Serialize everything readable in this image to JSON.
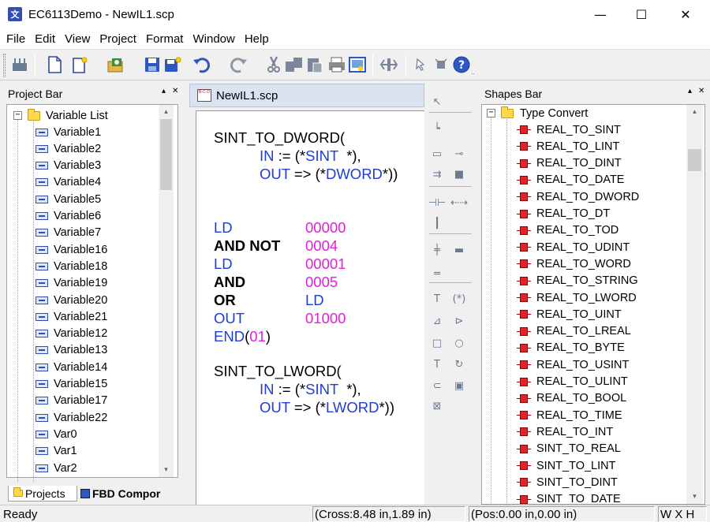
{
  "window": {
    "title": "EC6113Demo - NewIL1.scp",
    "icon_glyph": "文",
    "minimize_glyph": "—",
    "maximize_glyph": "☐",
    "close_glyph": "✕"
  },
  "menu": [
    "File",
    "Edit",
    "View",
    "Project",
    "Format",
    "Window",
    "Help"
  ],
  "toolbar": {
    "icons": [
      "build-icon",
      "new-document-icon",
      "new-from-template-icon",
      "open-project-icon",
      "save-icon",
      "save-all-icon",
      "undo-icon",
      "redo-icon",
      "cut-icon",
      "copy-icon",
      "paste-icon",
      "print-icon",
      "print-preview-icon",
      "split-icon",
      "pointer-icon",
      "stop-icon",
      "help-icon"
    ]
  },
  "project_bar": {
    "title": "Project Bar",
    "pin_glyph": "▴",
    "close_glyph": "✕",
    "root": {
      "label": "Variable List",
      "expander": "−"
    },
    "items": [
      "Variable1",
      "Variable2",
      "Variable3",
      "Variable4",
      "Variable5",
      "Variable6",
      "Variable7",
      "Variable16",
      "Variable18",
      "Variable19",
      "Variable20",
      "Variable21",
      "Variable12",
      "Variable13",
      "Variable14",
      "Variable15",
      "Variable17",
      "Variable22",
      "Var0",
      "Var1",
      "Var2"
    ],
    "tabs": [
      "Projects",
      "FBD Compor"
    ]
  },
  "document": {
    "tab_title": "NewIL1.scp",
    "tab_icon_text": "B-C-D"
  },
  "code": {
    "block1": {
      "func": "SINT_TO_DWORD(",
      "in_kw": "IN",
      "in_op": " := ",
      "in_open": "(*",
      "in_type": "SINT",
      "in_close": "  *),",
      "out_kw": "OUT",
      "out_op": " => ",
      "out_open": "(*",
      "out_type": "DWORD",
      "out_close": "*))"
    },
    "il_lines": [
      {
        "op": "LD",
        "arg": "00000"
      },
      {
        "op": "AND NOT",
        "arg": "0004"
      },
      {
        "op": "LD",
        "arg": "00001"
      },
      {
        "op": "AND",
        "arg": "0005"
      },
      {
        "op": "OR",
        "arg": "LD"
      },
      {
        "op": "OUT",
        "arg": "01000"
      }
    ],
    "end_kw": "END",
    "end_open": "(",
    "end_arg": "01",
    "end_close": ")",
    "block2": {
      "func": "SINT_TO_LWORD(",
      "in_kw": "IN",
      "in_op": " := ",
      "in_open": "(*",
      "in_type": "SINT",
      "in_close": "  *),",
      "out_kw": "OUT",
      "out_op": " => ",
      "out_open": "(*",
      "out_type": "LWORD",
      "out_close": "*))"
    }
  },
  "palette": {
    "icons": [
      "select-pointer-icon",
      "wire-icon",
      "contact-icon",
      "coil-icon",
      "branch-icon",
      "block-icon",
      "h-connect-icon",
      "h-disconnect-icon",
      "vertical-line-icon",
      "cross-icon",
      "element-icon",
      "horizontal-line-icon",
      "text-tool-icon",
      "comment-tool-icon",
      "polyline-icon",
      "polygon-icon",
      "rectangle-icon",
      "ellipse-icon",
      "label-text-icon",
      "rotate-icon",
      "arc-icon",
      "image-icon",
      "freeform-icon"
    ],
    "glyphs": [
      "↖",
      "┕",
      "▭",
      "⊸",
      "⇉",
      "■",
      "⊣⊢",
      "⇠⇢",
      "┃",
      "╪",
      "▬",
      "═",
      "T",
      "(*)",
      "⊿",
      "⊳",
      "□",
      "○",
      "T",
      "↻",
      "⊂",
      "▣",
      "⊠"
    ]
  },
  "shapes_bar": {
    "title": "Shapes Bar",
    "pin_glyph": "▴",
    "close_glyph": "✕",
    "root": {
      "label": "Type Convert",
      "expander": "−"
    },
    "items": [
      "REAL_TO_SINT",
      "REAL_TO_LINT",
      "REAL_TO_DINT",
      "REAL_TO_DATE",
      "REAL_TO_DWORD",
      "REAL_TO_DT",
      "REAL_TO_TOD",
      "REAL_TO_UDINT",
      "REAL_TO_WORD",
      "REAL_TO_STRING",
      "REAL_TO_LWORD",
      "REAL_TO_UINT",
      "REAL_TO_LREAL",
      "REAL_TO_BYTE",
      "REAL_TO_USINT",
      "REAL_TO_ULINT",
      "REAL_TO_BOOL",
      "REAL_TO_TIME",
      "REAL_TO_INT",
      "SINT_TO_REAL",
      "SINT_TO_LINT",
      "SINT_TO_DINT",
      "SINT_TO_DATE"
    ]
  },
  "status": {
    "ready": "Ready",
    "cross": "(Cross:8.48 in,1.89 in)",
    "pos": "(Pos:0.00 in,0.00 in)",
    "size": "W X H",
    "extra": "",
    "scroll_up": "▴",
    "scroll_down": "▾"
  }
}
